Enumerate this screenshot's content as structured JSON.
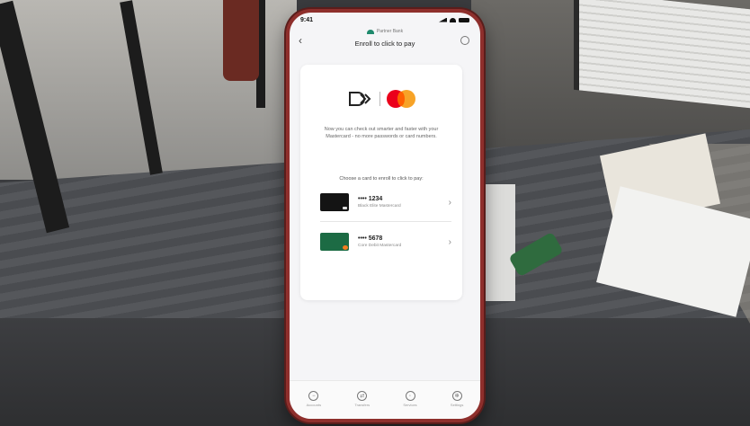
{
  "status_bar": {
    "time": "9:41"
  },
  "header": {
    "bank_name": "Partner Bank",
    "title": "Enroll to click to pay"
  },
  "content": {
    "description": "Now you can check out smarter and faster with your Mastercard - no more passwords or card numbers.",
    "choose_prompt": "Choose a card to enroll to click to pay:",
    "cards": [
      {
        "number": "•••• 1234",
        "name": "Black Elite Mastercard"
      },
      {
        "number": "•••• 5678",
        "name": "Core Debit Mastercard"
      }
    ]
  },
  "tabs": [
    {
      "label": "Accounts",
      "icon": "accounts-icon"
    },
    {
      "label": "Transfers",
      "icon": "transfers-icon"
    },
    {
      "label": "Services",
      "icon": "services-icon"
    },
    {
      "label": "Settings",
      "icon": "settings-icon"
    }
  ],
  "colors": {
    "phone_frame": "#8e2f2c",
    "mastercard_red": "#eb001b",
    "mastercard_yellow": "#f79e1b",
    "bank_accent": "#1f8a6d"
  }
}
